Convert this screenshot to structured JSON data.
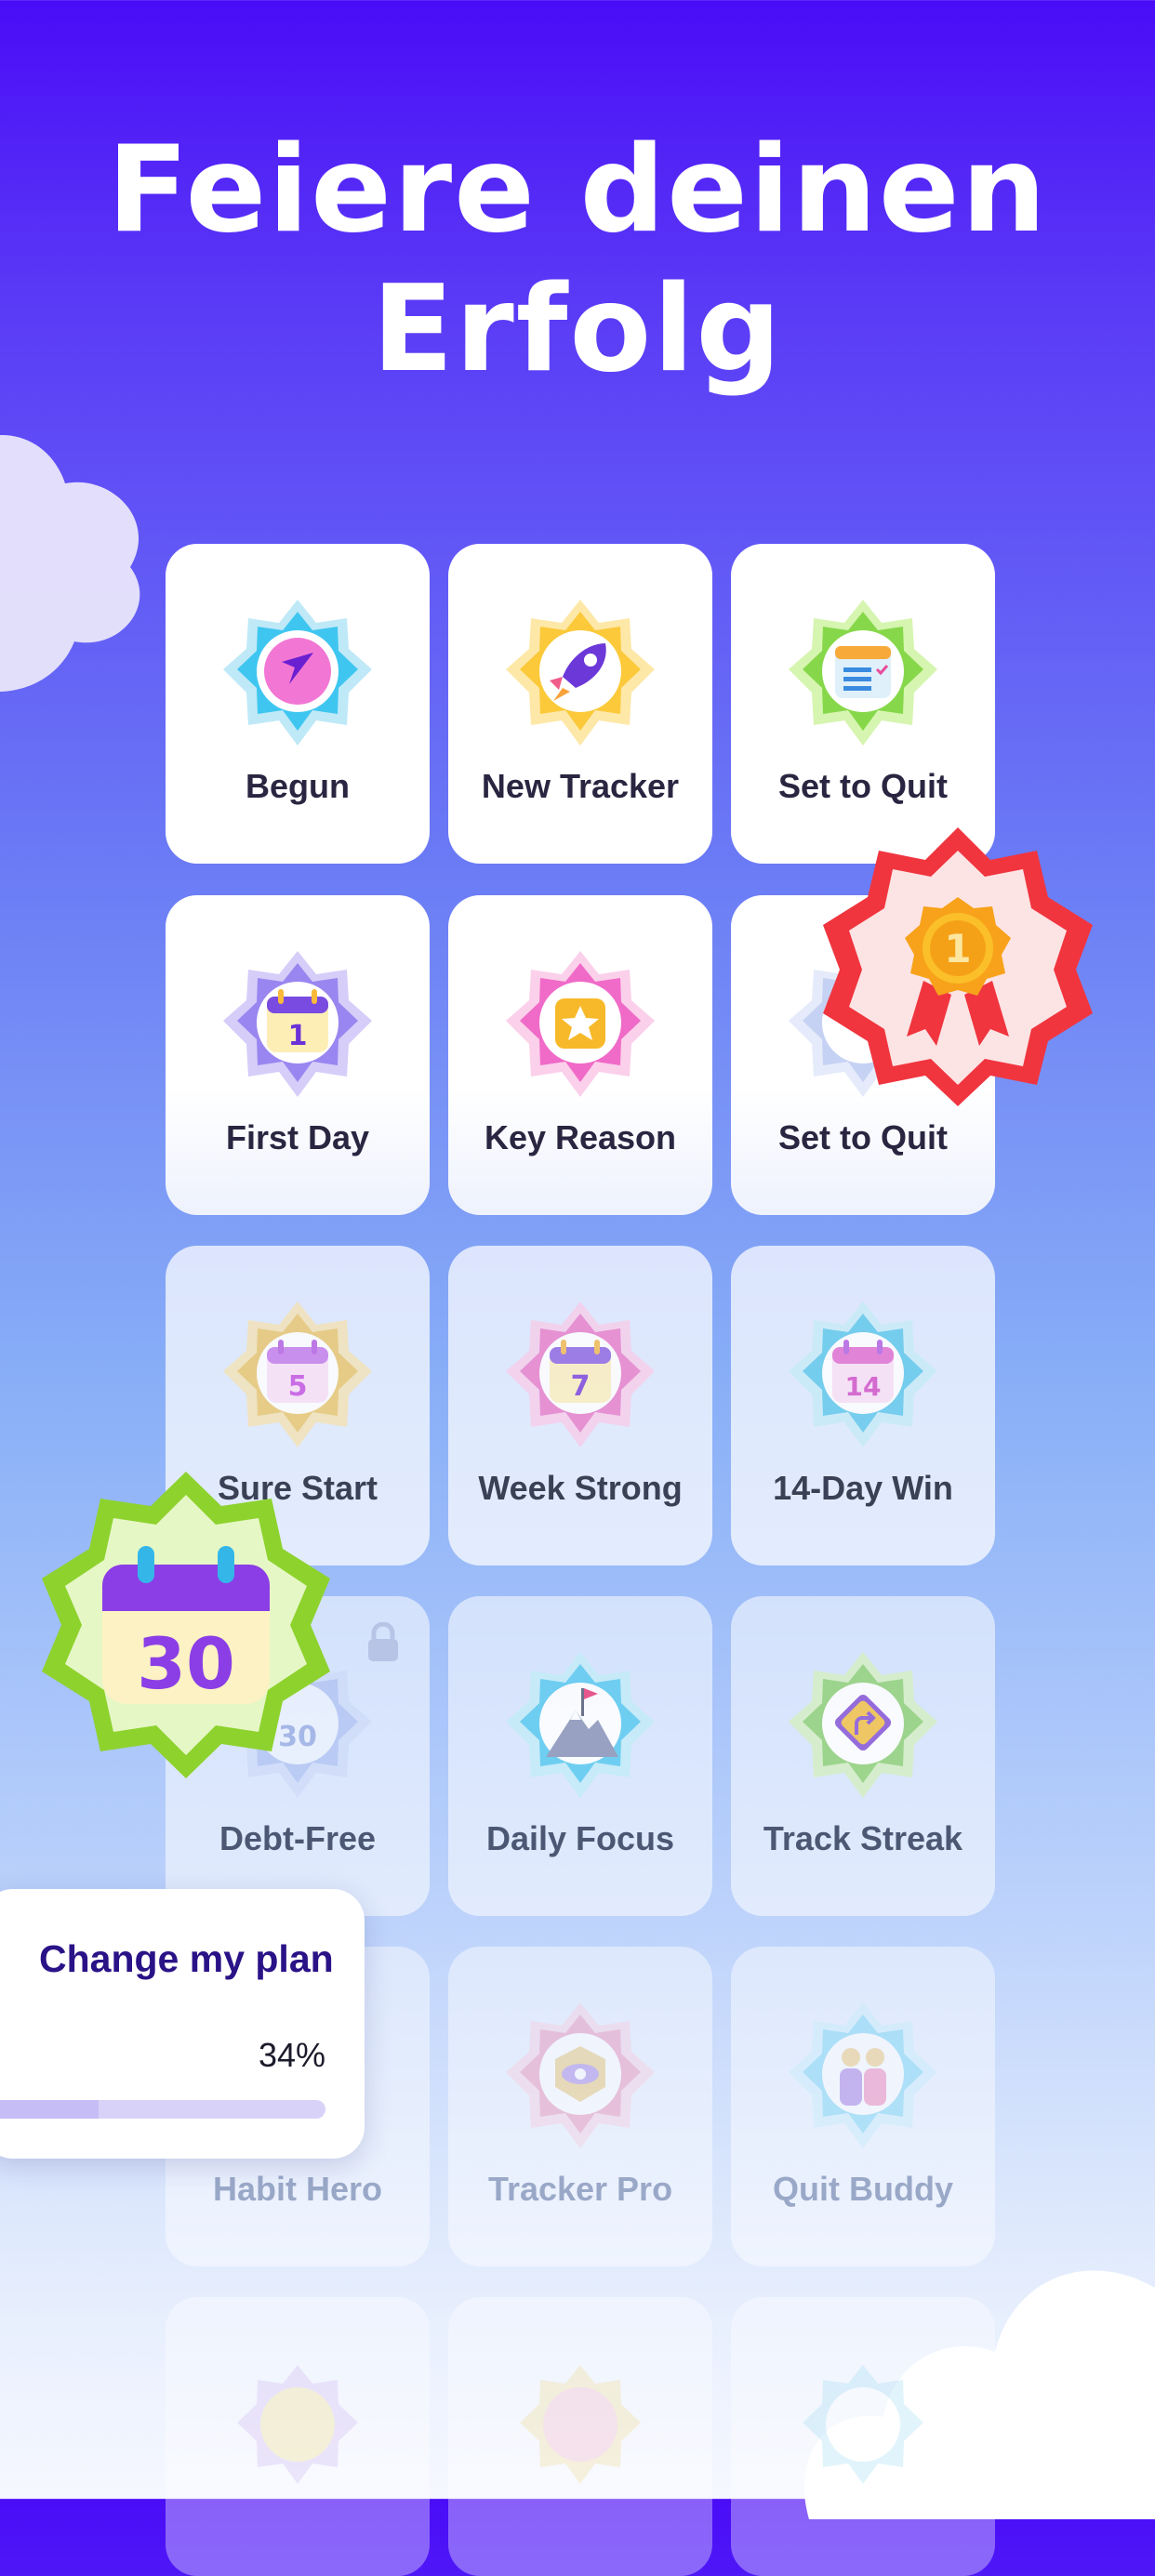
{
  "header": {
    "title_line1": "Feiere deinen",
    "title_line2": "Erfolg"
  },
  "achievements": [
    {
      "label": "Begun",
      "icon": "compass-icon"
    },
    {
      "label": "New Tracker",
      "icon": "rocket-icon"
    },
    {
      "label": "Set to Quit",
      "icon": "checklist-calendar-icon"
    },
    {
      "label": "First Day",
      "icon": "calendar-day-icon",
      "number": "1"
    },
    {
      "label": "Key Reason",
      "icon": "star-key-icon"
    },
    {
      "label": "Set to Quit",
      "icon": "badge-icon"
    },
    {
      "label": "Sure Start",
      "icon": "calendar-day-icon",
      "number": "5"
    },
    {
      "label": "Week Strong",
      "icon": "calendar-day-icon",
      "number": "7"
    },
    {
      "label": "14-Day Win",
      "icon": "calendar-day-icon",
      "number": "14"
    },
    {
      "label": "Debt-Free",
      "icon": "calendar-day-icon",
      "number": "30"
    },
    {
      "label": "Daily Focus",
      "icon": "mountain-flag-icon"
    },
    {
      "label": "Track Streak",
      "icon": "road-sign-icon"
    },
    {
      "label": "Habit Hero",
      "icon": "hero-icon"
    },
    {
      "label": "Tracker Pro",
      "icon": "eye-badge-icon"
    },
    {
      "label": "Quit Buddy",
      "icon": "buddies-icon"
    }
  ],
  "medal": {
    "number": "1"
  },
  "big_badge": {
    "number": "30"
  },
  "plan_card": {
    "title": "Change my plan",
    "percent_label": "34%",
    "progress": 0.34
  },
  "colors": {
    "accent": "#4a0cf7",
    "plan_title": "#2a1287",
    "medal_red": "#f0353f"
  }
}
